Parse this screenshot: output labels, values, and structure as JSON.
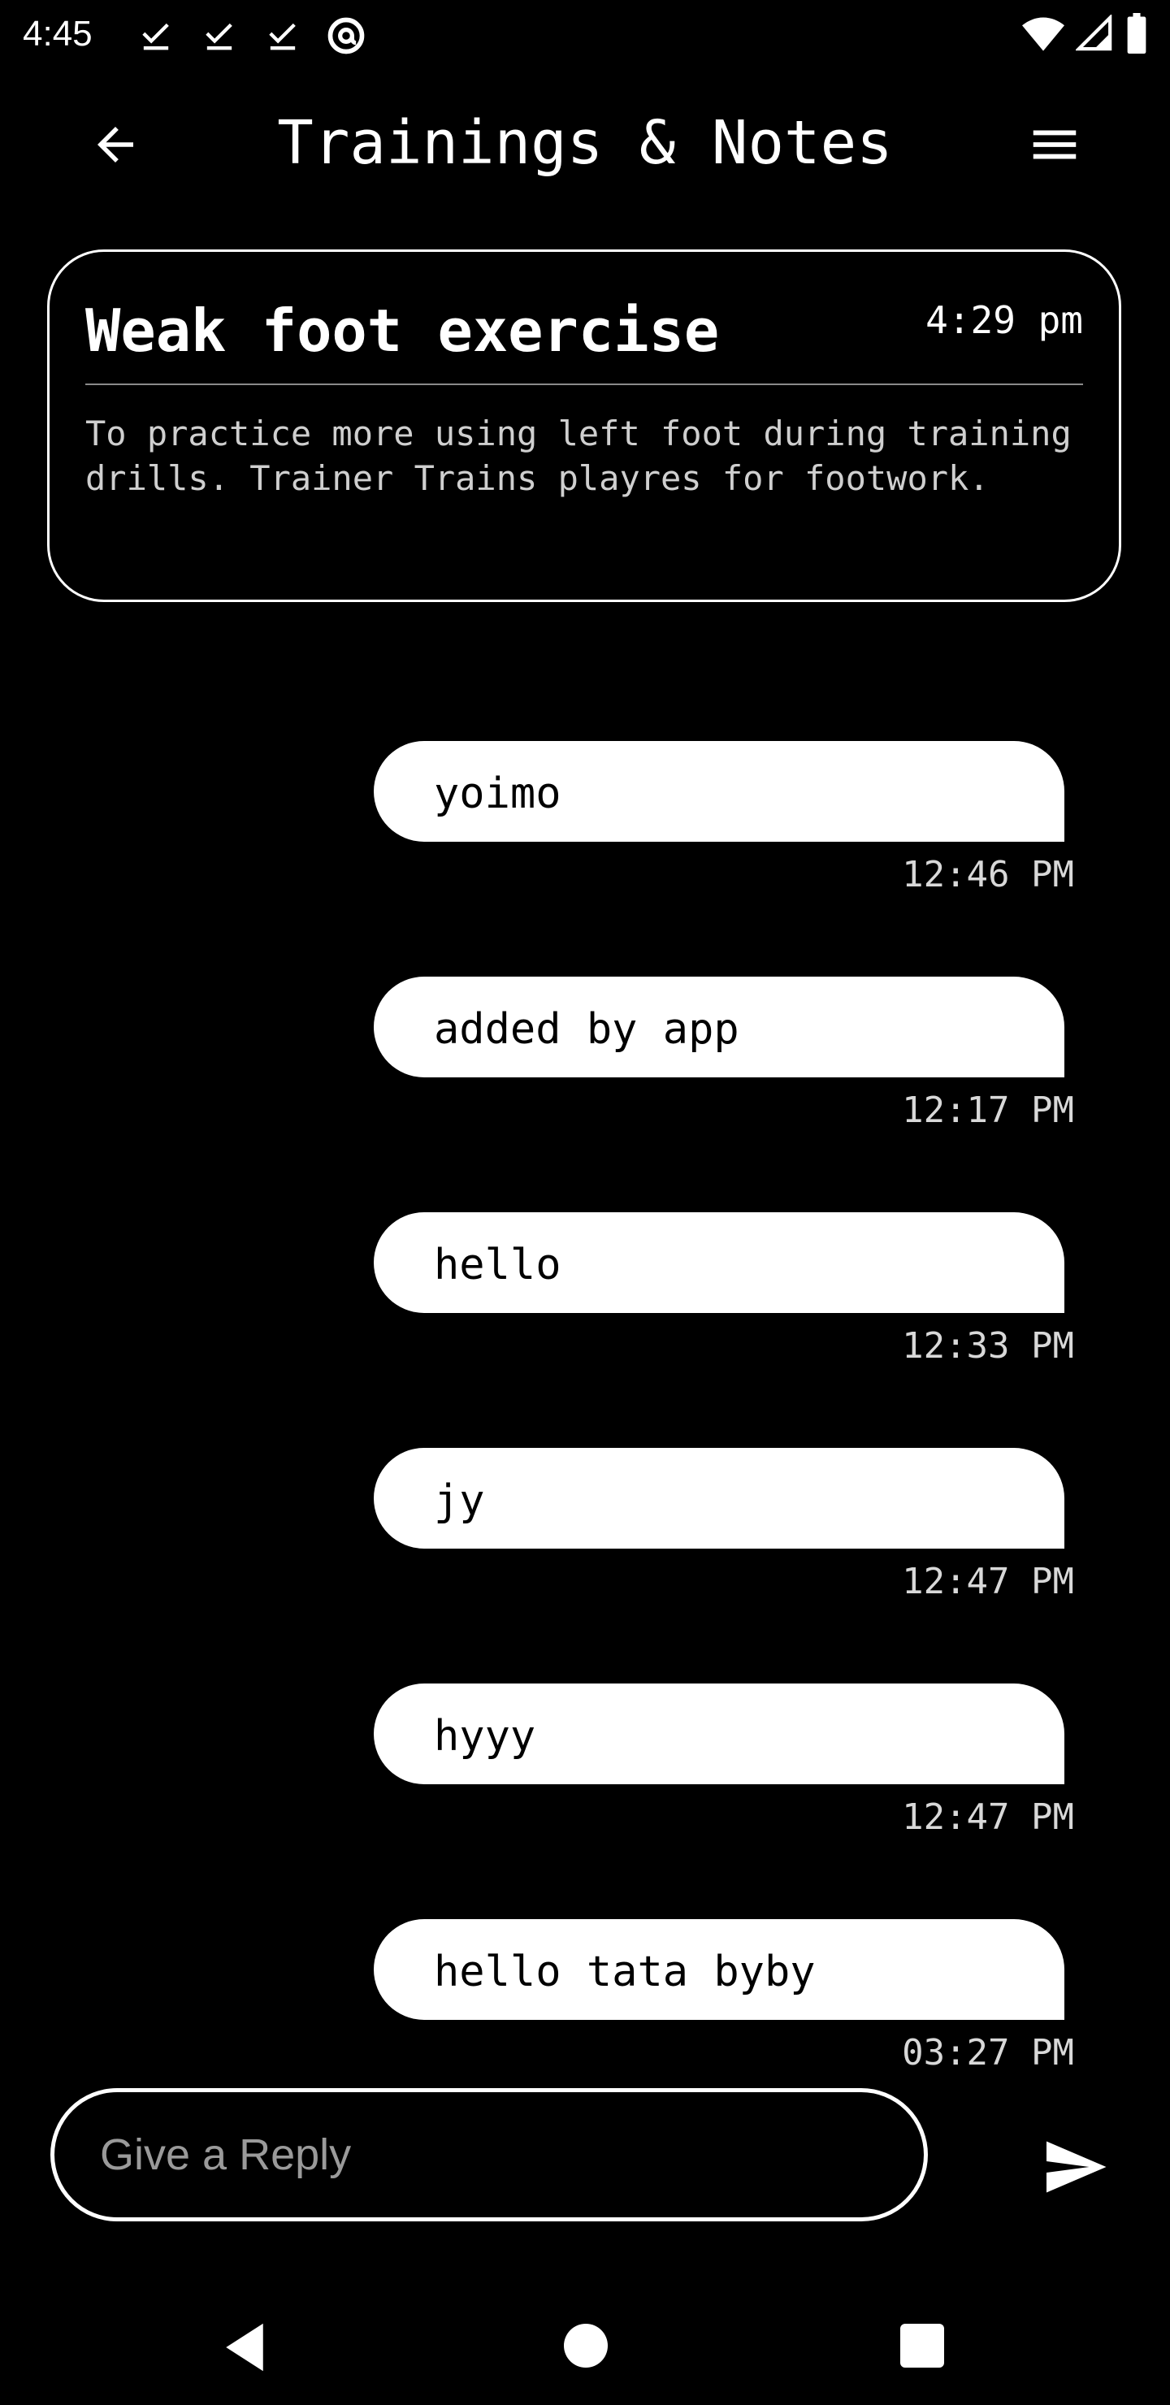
{
  "status_bar": {
    "time": "4:45",
    "icons": [
      "download-done-icon",
      "download-done-icon",
      "download-done-icon",
      "at-sign-icon",
      "wifi-icon",
      "signal-icon",
      "battery-icon"
    ]
  },
  "app_bar": {
    "title": "Trainings & Notes",
    "back_icon": "arrow-left-icon",
    "menu_icon": "menu-icon"
  },
  "note": {
    "title": "Weak foot exercise",
    "time": "4:29 pm",
    "body": "To practice more using left foot during training drills. Trainer Trains playres for footwork."
  },
  "messages": [
    {
      "text": "yoimo",
      "time": "12:46 PM"
    },
    {
      "text": "added by app",
      "time": "12:17 PM"
    },
    {
      "text": "hello",
      "time": "12:33 PM"
    },
    {
      "text": "jy",
      "time": "12:47 PM"
    },
    {
      "text": "hyyy",
      "time": "12:47 PM"
    },
    {
      "text": "hello tata byby",
      "time": "03:27 PM"
    }
  ],
  "reply": {
    "placeholder": "Give a Reply",
    "value": "",
    "send_icon": "send-icon"
  },
  "nav_bar": {
    "icons": [
      "nav-back-icon",
      "nav-home-icon",
      "nav-recents-icon"
    ]
  },
  "colors": {
    "background": "#000000",
    "foreground": "#ffffff",
    "muted_text": "#cfcfcf",
    "placeholder": "#9a9a9a"
  }
}
